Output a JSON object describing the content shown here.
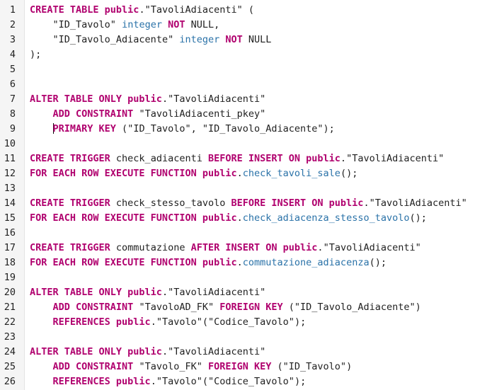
{
  "editor": {
    "lines": [
      {
        "n": "1",
        "tokens": [
          [
            "kw",
            "CREATE TABLE "
          ],
          [
            "schema",
            "public"
          ],
          [
            "punc",
            "."
          ],
          [
            "str",
            "\"TavoliAdiacenti\""
          ],
          [
            "punc",
            " ("
          ]
        ]
      },
      {
        "n": "2",
        "tokens": [
          [
            "punc",
            "    "
          ],
          [
            "str",
            "\"ID_Tavolo\""
          ],
          [
            "punc",
            " "
          ],
          [
            "fn",
            "integer"
          ],
          [
            "punc",
            " "
          ],
          [
            "kw",
            "NOT"
          ],
          [
            "punc",
            " NULL,"
          ]
        ]
      },
      {
        "n": "3",
        "tokens": [
          [
            "punc",
            "    "
          ],
          [
            "str",
            "\"ID_Tavolo_Adiacente\""
          ],
          [
            "punc",
            " "
          ],
          [
            "fn",
            "integer"
          ],
          [
            "punc",
            " "
          ],
          [
            "kw",
            "NOT"
          ],
          [
            "punc",
            " NULL"
          ]
        ]
      },
      {
        "n": "4",
        "tokens": [
          [
            "punc",
            ");"
          ]
        ]
      },
      {
        "n": "5",
        "tokens": []
      },
      {
        "n": "6",
        "tokens": []
      },
      {
        "n": "7",
        "tokens": [
          [
            "kw",
            "ALTER TABLE ONLY "
          ],
          [
            "schema",
            "public"
          ],
          [
            "punc",
            "."
          ],
          [
            "str",
            "\"TavoliAdiacenti\""
          ]
        ]
      },
      {
        "n": "8",
        "tokens": [
          [
            "punc",
            "    "
          ],
          [
            "kw",
            "ADD CONSTRAINT "
          ],
          [
            "str",
            "\"TavoliAdiacenti_pkey\""
          ]
        ]
      },
      {
        "n": "9",
        "tokens": [
          [
            "punc",
            "    "
          ],
          [
            "caret",
            ""
          ],
          [
            "kw",
            "PRIMARY KEY"
          ],
          [
            "punc",
            " ("
          ],
          [
            "str",
            "\"ID_Tavolo\""
          ],
          [
            "punc",
            ", "
          ],
          [
            "str",
            "\"ID_Tavolo_Adiacente\""
          ],
          [
            "punc",
            ");"
          ]
        ]
      },
      {
        "n": "10",
        "tokens": []
      },
      {
        "n": "11",
        "tokens": [
          [
            "kw",
            "CREATE TRIGGER "
          ],
          [
            "punc",
            "check_adiacenti "
          ],
          [
            "kw",
            "BEFORE INSERT ON "
          ],
          [
            "schema",
            "public"
          ],
          [
            "punc",
            "."
          ],
          [
            "str",
            "\"TavoliAdiacenti\""
          ]
        ]
      },
      {
        "n": "12",
        "tokens": [
          [
            "kw",
            "FOR EACH ROW EXECUTE FUNCTION "
          ],
          [
            "schema",
            "public"
          ],
          [
            "punc",
            "."
          ],
          [
            "fn",
            "check_tavoli_sale"
          ],
          [
            "punc",
            "();"
          ]
        ]
      },
      {
        "n": "13",
        "tokens": []
      },
      {
        "n": "14",
        "tokens": [
          [
            "kw",
            "CREATE TRIGGER "
          ],
          [
            "punc",
            "check_stesso_tavolo "
          ],
          [
            "kw",
            "BEFORE INSERT ON "
          ],
          [
            "schema",
            "public"
          ],
          [
            "punc",
            "."
          ],
          [
            "str",
            "\"TavoliAdiacenti\""
          ]
        ]
      },
      {
        "n": "15",
        "tokens": [
          [
            "kw",
            "FOR EACH ROW EXECUTE FUNCTION "
          ],
          [
            "schema",
            "public"
          ],
          [
            "punc",
            "."
          ],
          [
            "fn",
            "check_adiacenza_stesso_tavolo"
          ],
          [
            "punc",
            "();"
          ]
        ]
      },
      {
        "n": "16",
        "tokens": []
      },
      {
        "n": "17",
        "tokens": [
          [
            "kw",
            "CREATE TRIGGER "
          ],
          [
            "punc",
            "commutazione "
          ],
          [
            "kw",
            "AFTER INSERT ON "
          ],
          [
            "schema",
            "public"
          ],
          [
            "punc",
            "."
          ],
          [
            "str",
            "\"TavoliAdiacenti\""
          ]
        ]
      },
      {
        "n": "18",
        "tokens": [
          [
            "kw",
            "FOR EACH ROW EXECUTE FUNCTION "
          ],
          [
            "schema",
            "public"
          ],
          [
            "punc",
            "."
          ],
          [
            "fn",
            "commutazione_adiacenza"
          ],
          [
            "punc",
            "();"
          ]
        ]
      },
      {
        "n": "19",
        "tokens": []
      },
      {
        "n": "20",
        "tokens": [
          [
            "kw",
            "ALTER TABLE ONLY "
          ],
          [
            "schema",
            "public"
          ],
          [
            "punc",
            "."
          ],
          [
            "str",
            "\"TavoliAdiacenti\""
          ]
        ]
      },
      {
        "n": "21",
        "tokens": [
          [
            "punc",
            "    "
          ],
          [
            "kw",
            "ADD CONSTRAINT "
          ],
          [
            "str",
            "\"TavoloAD_FK\""
          ],
          [
            "punc",
            " "
          ],
          [
            "kw",
            "FOREIGN KEY"
          ],
          [
            "punc",
            " ("
          ],
          [
            "str",
            "\"ID_Tavolo_Adiacente\""
          ],
          [
            "punc",
            ")"
          ]
        ]
      },
      {
        "n": "22",
        "tokens": [
          [
            "punc",
            "    "
          ],
          [
            "kw",
            "REFERENCES "
          ],
          [
            "schema",
            "public"
          ],
          [
            "punc",
            "."
          ],
          [
            "str",
            "\"Tavolo\""
          ],
          [
            "punc",
            "("
          ],
          [
            "str",
            "\"Codice_Tavolo\""
          ],
          [
            "punc",
            ");"
          ]
        ]
      },
      {
        "n": "23",
        "tokens": []
      },
      {
        "n": "24",
        "tokens": [
          [
            "kw",
            "ALTER TABLE ONLY "
          ],
          [
            "schema",
            "public"
          ],
          [
            "punc",
            "."
          ],
          [
            "str",
            "\"TavoliAdiacenti\""
          ]
        ]
      },
      {
        "n": "25",
        "tokens": [
          [
            "punc",
            "    "
          ],
          [
            "kw",
            "ADD CONSTRAINT "
          ],
          [
            "str",
            "\"Tavolo_FK\""
          ],
          [
            "punc",
            " "
          ],
          [
            "kw",
            "FOREIGN KEY"
          ],
          [
            "punc",
            " ("
          ],
          [
            "str",
            "\"ID_Tavolo\""
          ],
          [
            "punc",
            ")"
          ]
        ]
      },
      {
        "n": "26",
        "tokens": [
          [
            "punc",
            "    "
          ],
          [
            "kw",
            "REFERENCES "
          ],
          [
            "schema",
            "public"
          ],
          [
            "punc",
            "."
          ],
          [
            "str",
            "\"Tavolo\""
          ],
          [
            "punc",
            "("
          ],
          [
            "str",
            "\"Codice_Tavolo\""
          ],
          [
            "punc",
            ");"
          ]
        ]
      }
    ]
  },
  "colors": {
    "keyword": "#b0006e",
    "function": "#2a72a8",
    "text": "#1f1f1f",
    "gutter_bg": "#f5f5f5"
  }
}
